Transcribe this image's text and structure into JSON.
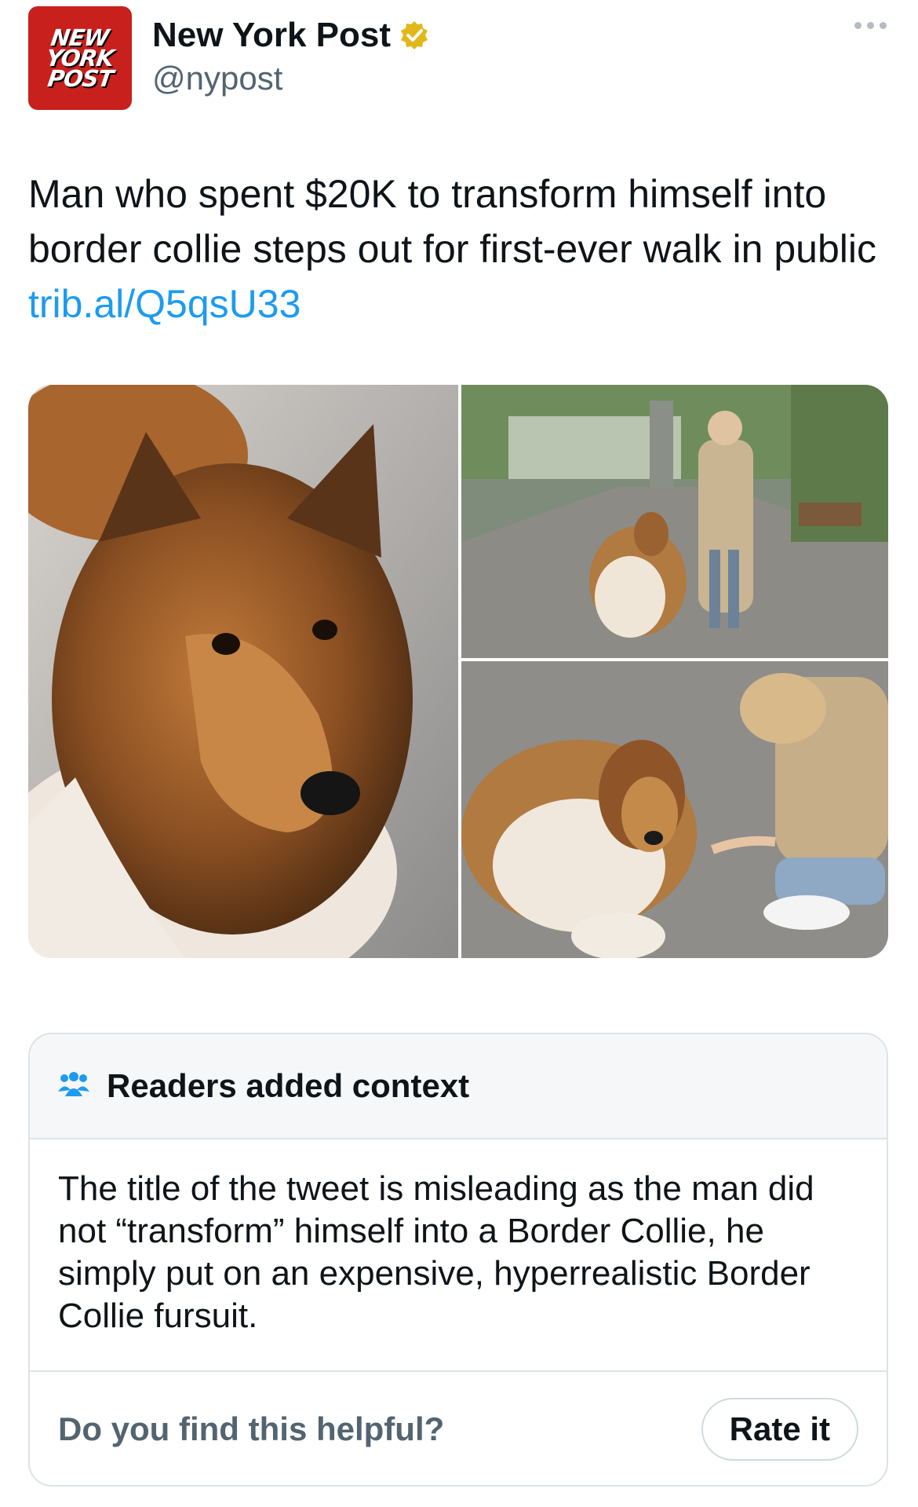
{
  "author": {
    "logo_lines": [
      "NEW",
      "YORK",
      "POST"
    ],
    "name": "New York Post",
    "handle": "@nypost",
    "verified": true,
    "verified_color": "#e2b719"
  },
  "tweet": {
    "text": "Man who spent $20K to transform himself into border collie steps out for first-ever walk in public ",
    "link": "trib.al/Q5qsU33",
    "link_color": "#1d9bf0"
  },
  "media": [
    {
      "icon": "dog-closeup-photo"
    },
    {
      "icon": "woman-walking-dog-photo"
    },
    {
      "icon": "woman-greeting-dog-photo"
    }
  ],
  "community_note": {
    "title": "Readers added context",
    "body": "The title of the tweet is misleading as the man did not “transform” himself into a Border Collie, he simply put on an expensive, hyperrealistic Border Collie fursuit.",
    "question": "Do you find this helpful?",
    "rate_label": "Rate it",
    "icon": "people-icon",
    "icon_color": "#1d9bf0"
  }
}
